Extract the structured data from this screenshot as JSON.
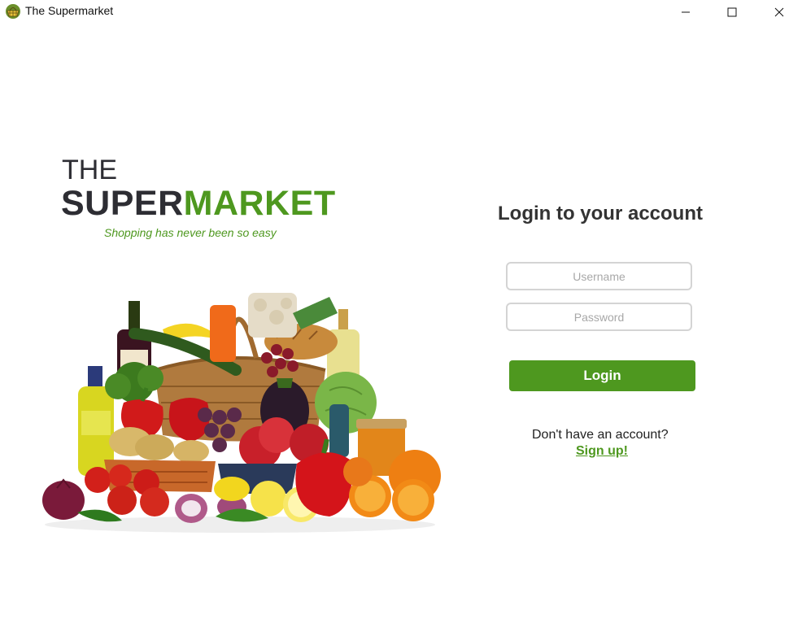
{
  "window": {
    "title": "The Supermarket",
    "app_icon": "basket-icon",
    "controls": [
      "minimize-icon",
      "maximize-icon",
      "close-icon"
    ]
  },
  "brand": {
    "line1": "THE",
    "line2_part1": "SUPER",
    "line2_part2": "MARKET",
    "tagline": "Shopping has never been so easy",
    "colors": {
      "dark": "#2d2d33",
      "green": "#4e981f"
    }
  },
  "hero_image": "grocery-produce-basket-image",
  "login": {
    "heading": "Login to your account",
    "username_placeholder": "Username",
    "username_value": "",
    "password_placeholder": "Password",
    "password_value": "",
    "submit_label": "Login",
    "no_account_text": "Don't have an account?",
    "signup_label": "Sign up!"
  }
}
